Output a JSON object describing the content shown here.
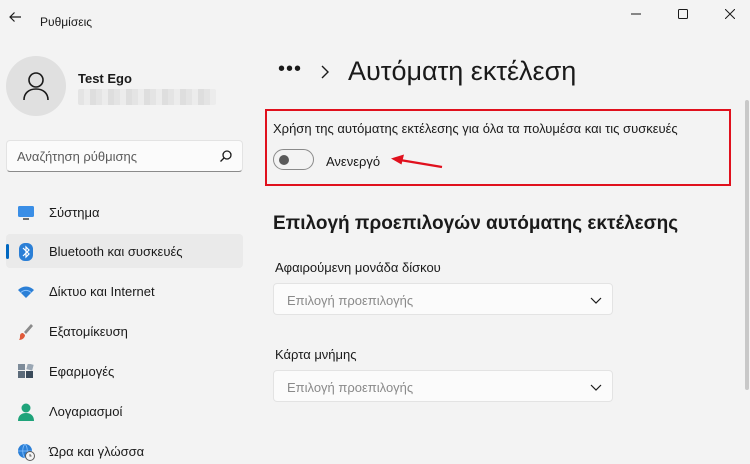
{
  "window": {
    "title": "Ρυθμίσεις"
  },
  "user": {
    "name": "Test Ego"
  },
  "search": {
    "placeholder": "Αναζήτηση ρύθμισης"
  },
  "nav": {
    "items": [
      {
        "label": "Σύστημα",
        "icon": "monitor-icon"
      },
      {
        "label": "Bluetooth και συσκευές",
        "icon": "bluetooth-icon",
        "active": true
      },
      {
        "label": "Δίκτυο και Internet",
        "icon": "wifi-icon"
      },
      {
        "label": "Εξατομίκευση",
        "icon": "brush-icon"
      },
      {
        "label": "Εφαρμογές",
        "icon": "apps-icon"
      },
      {
        "label": "Λογαριασμοί",
        "icon": "account-icon"
      },
      {
        "label": "Ώρα και γλώσσα",
        "icon": "globe-clock-icon"
      }
    ]
  },
  "breadcrumb": {
    "dots": "•••"
  },
  "page": {
    "title": "Αυτόματη εκτέλεση"
  },
  "autoplay": {
    "label": "Χρήση της αυτόματης εκτέλεσης για όλα τα πολυμέσα και τις συσκευές",
    "toggle_state": "Ανενεργό",
    "toggle_on": false
  },
  "defaults": {
    "section_title": "Επιλογή προεπιλογών αυτόματης εκτέλεσης",
    "fields": [
      {
        "label": "Αφαιρούμενη μονάδα δίσκου",
        "value": "Επιλογή προεπιλογής"
      },
      {
        "label": "Κάρτα μνήμης",
        "value": "Επιλογή προεπιλογής"
      }
    ]
  },
  "colors": {
    "accent": "#0067c0",
    "annotation_red": "#e0101d",
    "background": "#f3f3f3"
  }
}
